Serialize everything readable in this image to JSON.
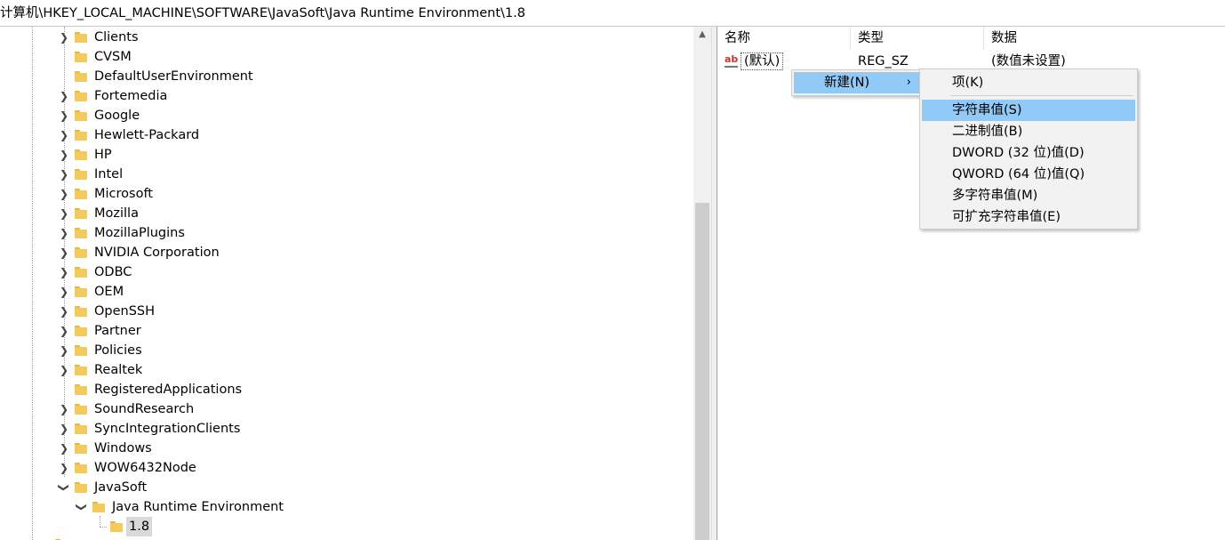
{
  "address_bar": {
    "path": "计算机\\HKEY_LOCAL_MACHINE\\SOFTWARE\\JavaSoft\\Java Runtime Environment\\1.8"
  },
  "tree": {
    "items": [
      {
        "label": "Clients",
        "expandable": true
      },
      {
        "label": "CVSM",
        "expandable": false
      },
      {
        "label": "DefaultUserEnvironment",
        "expandable": false
      },
      {
        "label": "Fortemedia",
        "expandable": true
      },
      {
        "label": "Google",
        "expandable": true
      },
      {
        "label": "Hewlett-Packard",
        "expandable": true
      },
      {
        "label": "HP",
        "expandable": true
      },
      {
        "label": "Intel",
        "expandable": true
      },
      {
        "label": "Microsoft",
        "expandable": true
      },
      {
        "label": "Mozilla",
        "expandable": true
      },
      {
        "label": "MozillaPlugins",
        "expandable": true
      },
      {
        "label": "NVIDIA Corporation",
        "expandable": true
      },
      {
        "label": "ODBC",
        "expandable": true
      },
      {
        "label": "OEM",
        "expandable": true
      },
      {
        "label": "OpenSSH",
        "expandable": true
      },
      {
        "label": "Partner",
        "expandable": true
      },
      {
        "label": "Policies",
        "expandable": true
      },
      {
        "label": "Realtek",
        "expandable": true
      },
      {
        "label": "RegisteredApplications",
        "expandable": false
      },
      {
        "label": "SoundResearch",
        "expandable": true
      },
      {
        "label": "SyncIntegrationClients",
        "expandable": true
      },
      {
        "label": "Windows",
        "expandable": true
      },
      {
        "label": "WOW6432Node",
        "expandable": true
      },
      {
        "label": "JavaSoft",
        "expanded": true
      },
      {
        "label": "Java Runtime Environment",
        "expanded": true
      },
      {
        "label": "1.8",
        "selected": true
      }
    ]
  },
  "values_pane": {
    "columns": {
      "name": "名称",
      "type": "类型",
      "data": "数据"
    },
    "rows": [
      {
        "name": "(默认)",
        "type": "REG_SZ",
        "data": "(数值未设置)"
      }
    ]
  },
  "context_menu": {
    "new_label": "新建(N)",
    "submenu": [
      {
        "label": "项(K)"
      },
      {
        "label": "字符串值(S)",
        "highlighted": true
      },
      {
        "label": "二进制值(B)"
      },
      {
        "label": "DWORD (32 位)值(D)"
      },
      {
        "label": "QWORD (64 位)值(Q)"
      },
      {
        "label": "多字符串值(M)"
      },
      {
        "label": "可扩充字符串值(E)"
      }
    ]
  },
  "colors": {
    "highlight": "#91c9f7",
    "folder": "#f3ca5d",
    "menu_bg": "#f2f2f2"
  }
}
